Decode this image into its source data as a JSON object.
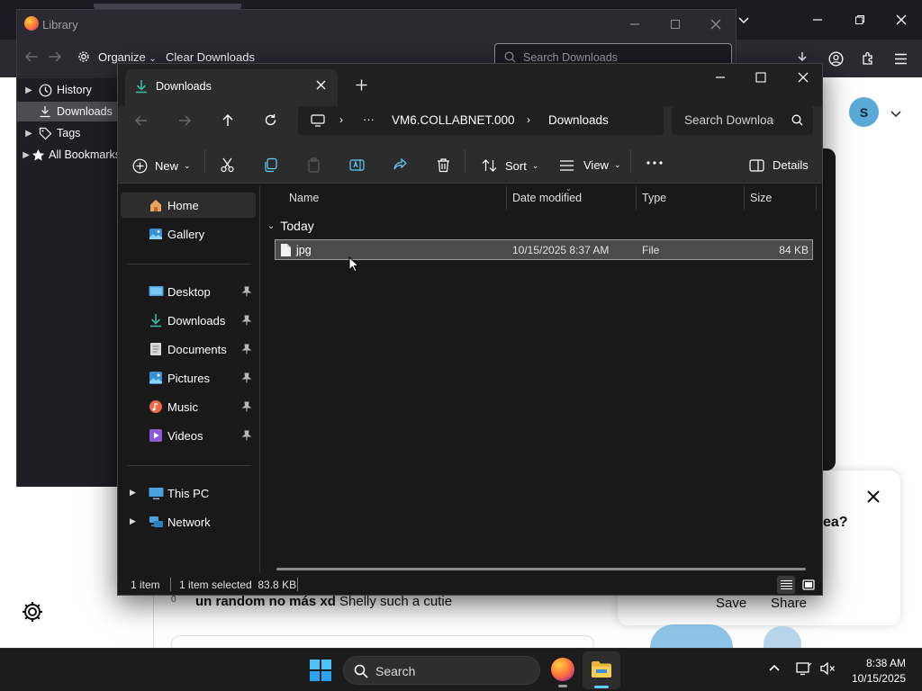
{
  "library": {
    "title": "Library",
    "organize_label": "Organize",
    "clear_downloads_label": "Clear Downloads",
    "search_placeholder": "Search Downloads",
    "tree": [
      {
        "label": "History",
        "icon": "clock-icon"
      },
      {
        "label": "Downloads",
        "icon": "download-icon"
      },
      {
        "label": "Tags",
        "icon": "tag-icon"
      },
      {
        "label": "All Bookmarks",
        "icon": "star-icon"
      }
    ]
  },
  "explorer": {
    "tab_title": "Downloads",
    "address": {
      "path": [
        "VM6.COLLABNET.000",
        "Downloads"
      ],
      "overflow": "···"
    },
    "search_placeholder": "Search Downloads",
    "toolbar": {
      "new_label": "New",
      "sort_label": "Sort",
      "view_label": "View",
      "details_label": "Details"
    },
    "nav": {
      "top": [
        {
          "label": "Home",
          "icon": "home-icon"
        },
        {
          "label": "Gallery",
          "icon": "gallery-icon"
        }
      ],
      "quick": [
        {
          "label": "Desktop",
          "icon": "desktop-icon"
        },
        {
          "label": "Downloads",
          "icon": "download-icon"
        },
        {
          "label": "Documents",
          "icon": "documents-icon"
        },
        {
          "label": "Pictures",
          "icon": "pictures-icon"
        },
        {
          "label": "Music",
          "icon": "music-icon"
        },
        {
          "label": "Videos",
          "icon": "videos-icon"
        }
      ],
      "bottom": [
        {
          "label": "This PC",
          "icon": "pc-icon"
        },
        {
          "label": "Network",
          "icon": "network-icon"
        }
      ]
    },
    "columns": {
      "name": "Name",
      "date": "Date modified",
      "type": "Type",
      "size": "Size"
    },
    "group_label": "Today",
    "files": [
      {
        "name": "jpg",
        "date": "10/15/2025 8:37 AM",
        "type": "File",
        "size": "84 KB"
      }
    ],
    "status": {
      "count": "1 item",
      "selected": "1 item selected  83.8 KB"
    }
  },
  "browser": {
    "avatar_initial": "S",
    "comment_author": "un random no más xd",
    "comment_text": "Shelly such a cutie",
    "comment_num": "0",
    "promo_text": "ea?",
    "save_label": "Save",
    "share_label": "Share"
  },
  "taskbar": {
    "search_label": "Search",
    "time": "8:38 AM",
    "date": "10/15/2025"
  },
  "colors": {
    "explorer_bg": "#191919",
    "library_bg": "#2b2a33",
    "selection": "#4d4c55",
    "accent": "#60cdff"
  }
}
